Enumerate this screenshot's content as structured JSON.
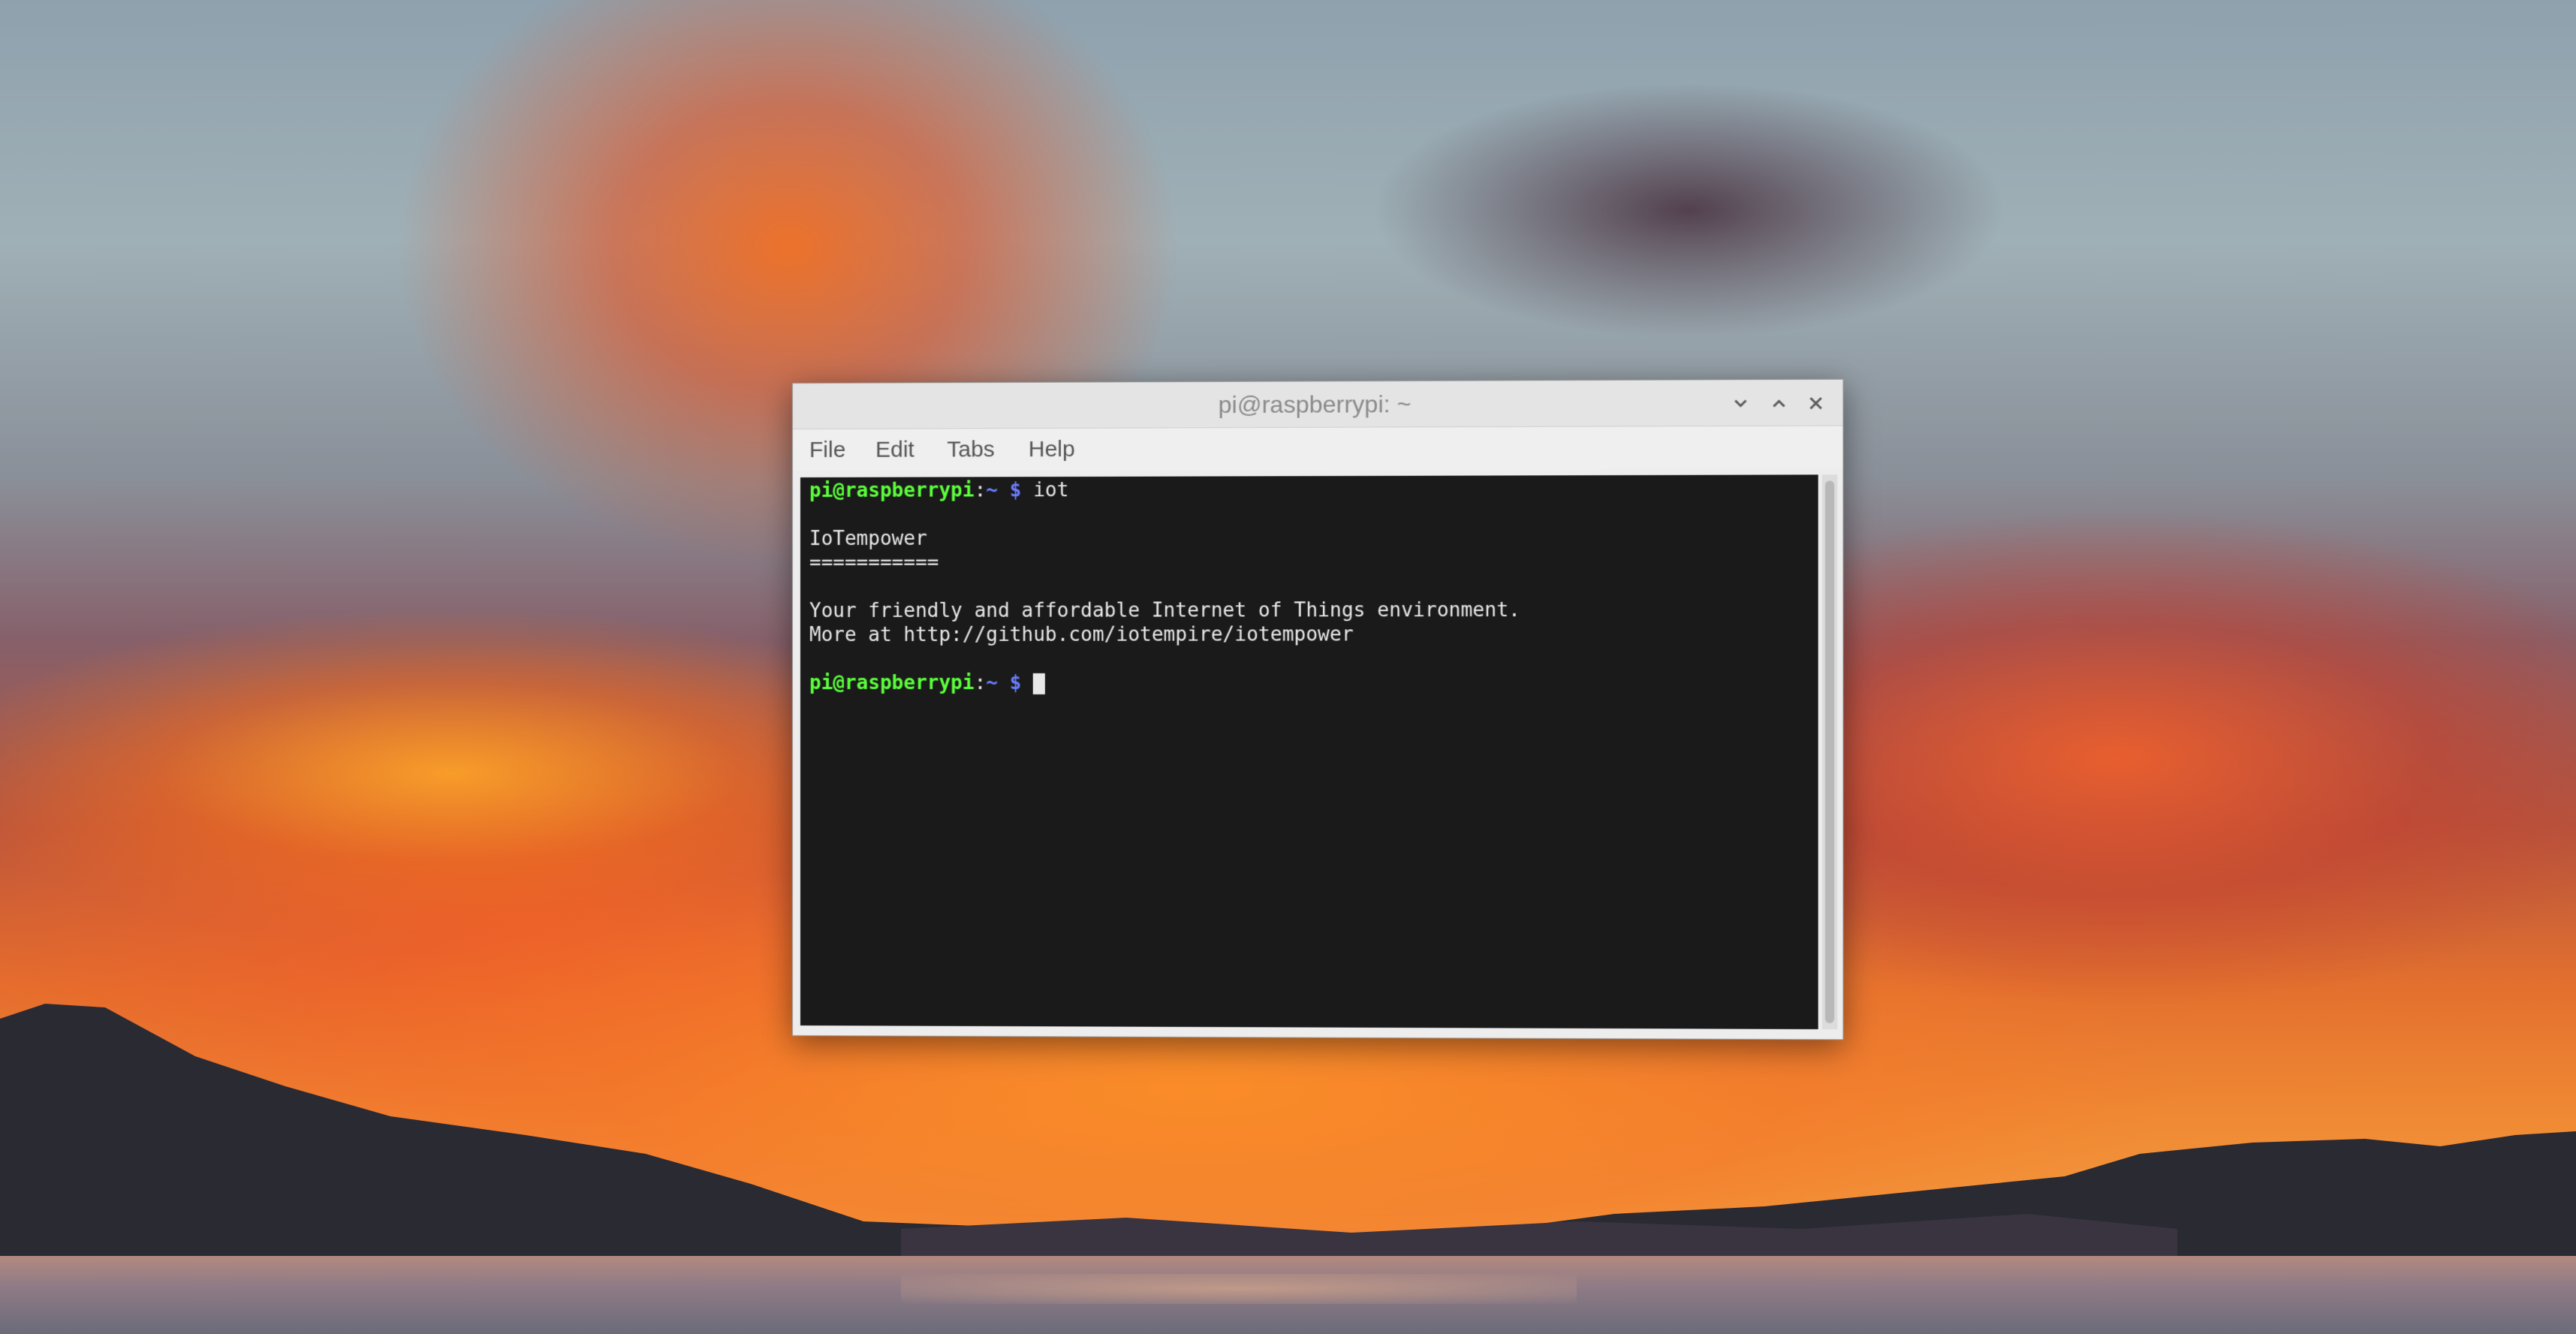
{
  "window": {
    "title": "pi@raspberrypi: ~",
    "controls": {
      "minimize_icon": "chevron-down",
      "maximize_icon": "chevron-up",
      "close_icon": "x"
    }
  },
  "menu": {
    "file": "File",
    "edit": "Edit",
    "tabs": "Tabs",
    "help": "Help"
  },
  "terminal": {
    "prompt": {
      "user_host": "pi@raspberrypi",
      "separator": ":",
      "path": "~ $"
    },
    "command": "iot",
    "output": {
      "heading": "IoTempower",
      "underline": "===========",
      "tagline": "Your friendly and affordable Internet of Things environment.",
      "more": "More at http://github.com/iotempire/iotempower"
    }
  },
  "colors": {
    "prompt_user": "#5aff3a",
    "prompt_path": "#6a7dff",
    "terminal_bg": "#1a1a1a",
    "terminal_fg": "#e8e8e8"
  }
}
